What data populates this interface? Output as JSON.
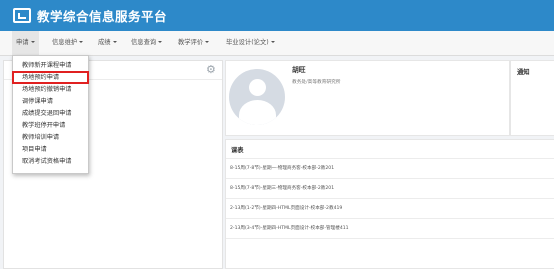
{
  "header": {
    "title": "教学综合信息服务平台",
    "bar_color": "#2d89c9"
  },
  "nav": {
    "items": [
      {
        "label": "申请",
        "active": true
      },
      {
        "label": "信息维护"
      },
      {
        "label": "成绩"
      },
      {
        "label": "信息查询"
      },
      {
        "label": "教学评价"
      },
      {
        "label": "毕业设计(论文)"
      }
    ]
  },
  "dropdown": {
    "items": [
      "教师新开课程申请",
      "场地预约申请",
      "场地预约撤销申请",
      "调停课申请",
      "成绩提交退回申请",
      "教学班停开申请",
      "教师培训申请",
      "项目申请",
      "取消考试资格申请"
    ],
    "highlighted_index": 1,
    "highlight_color": "#e02020"
  },
  "profile": {
    "name": "胡旺",
    "department": "教务处/高等教育研究所"
  },
  "notice": {
    "title": "通知"
  },
  "schedule": {
    "title": "课表",
    "rows": [
      "8-15周(7-8节)-星期一-物理商务客-校本部-2教201",
      "8-15周(7-8节)-星期三-物理商务客-校本部-2教201",
      "2-13周(1-2节)-星期四-HTML页面设计-校本部-2教419",
      "2-13周(3-4节)-星期四-HTML页面设计-校本部-管理楼411"
    ]
  },
  "icons": {
    "logo": "monitor-check-icon",
    "settings": "gear-icon",
    "avatar": "user-avatar-icon"
  }
}
